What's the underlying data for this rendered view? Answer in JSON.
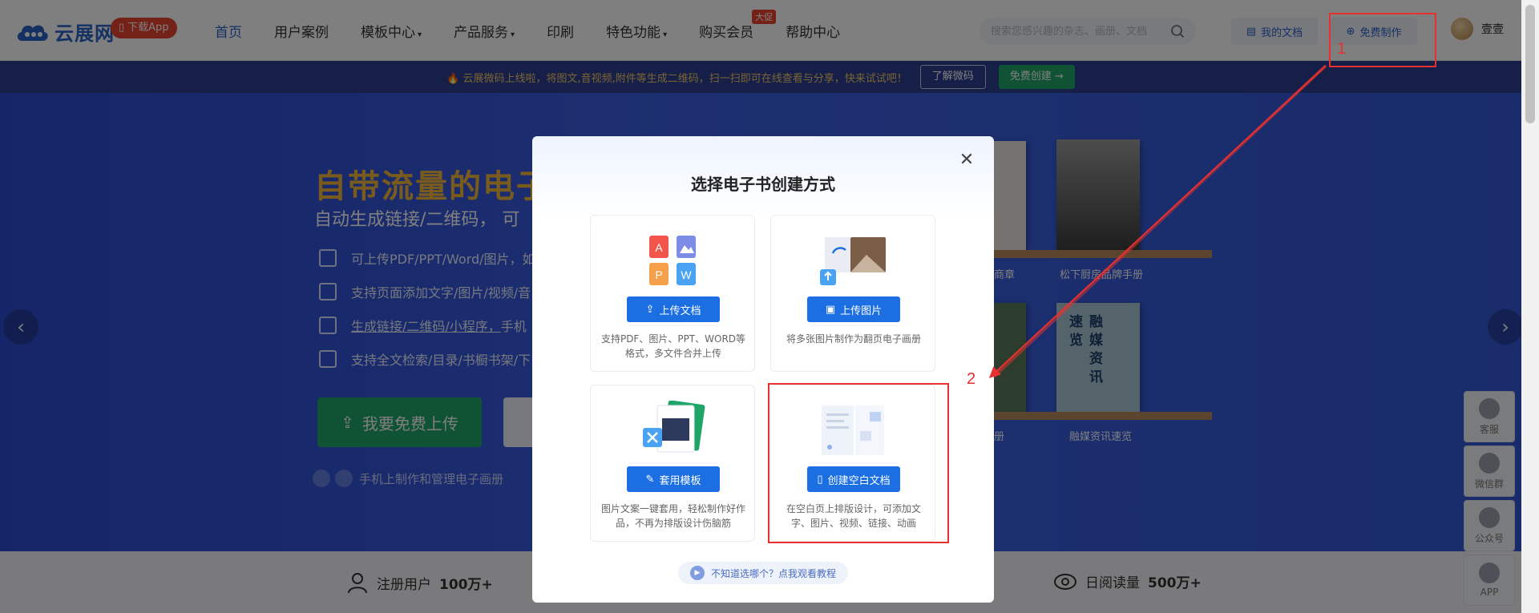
{
  "header": {
    "logo_text": "云展网",
    "app_badge": "下载App",
    "nav": [
      {
        "label": "首页",
        "active": true,
        "caret": false
      },
      {
        "label": "用户案例",
        "active": false,
        "caret": false
      },
      {
        "label": "模板中心",
        "active": false,
        "caret": true
      },
      {
        "label": "产品服务",
        "active": false,
        "caret": true
      },
      {
        "label": "印刷",
        "active": false,
        "caret": false
      },
      {
        "label": "特色功能",
        "active": false,
        "caret": true
      },
      {
        "label": "购买会员",
        "active": false,
        "caret": false,
        "tag": "大促"
      },
      {
        "label": "帮助中心",
        "active": false,
        "caret": false
      }
    ],
    "search_placeholder": "搜索您感兴趣的杂志、画册、文档",
    "my_docs": "我的文档",
    "free_make": "免费制作",
    "username": "壹壹"
  },
  "announcement": {
    "text": "🔥 云展微码上线啦，将图文,音视频,附件等生成二维码，扫一扫即可在线查看与分享，快来试试吧！",
    "learn_btn": "了解微码",
    "create_btn": "免费创建 →"
  },
  "hero": {
    "title": "自带流量的电子",
    "subtitle": "自动生成链接/二维码， 可",
    "features": [
      {
        "text": "可上传PDF/PPT/Word/图片，如",
        "underline": false
      },
      {
        "text": "支持页面添加文字/图片/视频/音",
        "underline": false
      },
      {
        "text": "生成链接/二维码/小程序，",
        "suffix": "手机",
        "underline": true
      },
      {
        "text": "支持全文检索/目录/书橱书架/下",
        "underline": false
      }
    ],
    "upload_btn": "我要免费上传",
    "mobile_hint": "手机上制作和管理电子画册",
    "shelf_labels": [
      "商章",
      "松下厨房品牌手册",
      "册",
      "融媒资讯速览"
    ],
    "book_vertical_title": "融媒资讯速览"
  },
  "stats": [
    {
      "label": "注册用户",
      "value": "100万+"
    },
    {
      "label": "日阅读量",
      "value": "500万+"
    }
  ],
  "float_bar": [
    "客服",
    "微信群",
    "公众号",
    "APP"
  ],
  "modal": {
    "title": "选择电子书创建方式",
    "options": [
      {
        "button": "上传文档",
        "desc": "支持PDF、图片、PPT、WORD等格式，多文件合并上传"
      },
      {
        "button": "上传图片",
        "desc": "将多张图片制作为翻页电子画册"
      },
      {
        "button": "套用模板",
        "desc": "图片文案一键套用，轻松制作好作品，不再为排版设计伤脑筋"
      },
      {
        "button": "创建空白文档",
        "desc": "在空白页上排版设计，可添加文字、图片、视频、链接、动画"
      }
    ],
    "tutorial": "不知道选哪个？点我观看教程"
  },
  "annotations": {
    "step1": "1",
    "step2": "2",
    "color": "#e8312f"
  }
}
